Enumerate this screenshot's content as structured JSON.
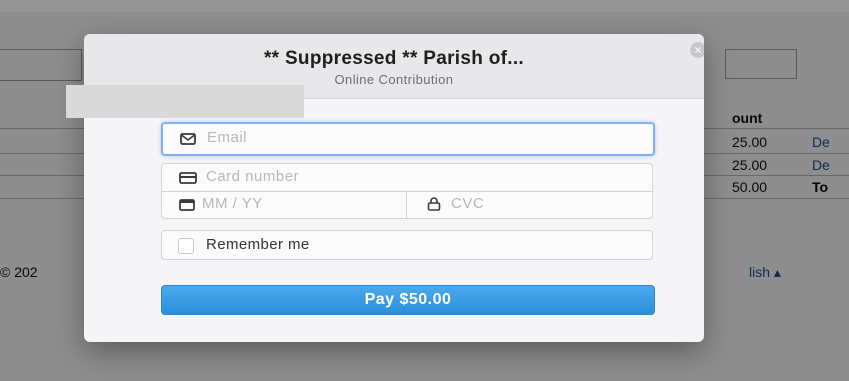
{
  "background": {
    "col_header": "ount",
    "rows": [
      {
        "amount": "25.00",
        "link": "De"
      },
      {
        "amount": "25.00",
        "link": "De"
      },
      {
        "amount": "50.00",
        "link": "To"
      }
    ],
    "footer_left": "© 202",
    "footer_right": "lish ▴"
  },
  "modal": {
    "title": "** Suppressed ** Parish of...",
    "subtitle": "Online Contribution",
    "close_icon": "close-icon",
    "email_placeholder": "Email",
    "card_placeholder": "Card number",
    "expiry_placeholder": "MM / YY",
    "cvc_placeholder": "CVC",
    "remember_label": "Remember me",
    "pay_label": "Pay $50.00"
  },
  "colors": {
    "accent": "#2a8fdc",
    "focus_border": "#7fb2f0"
  }
}
